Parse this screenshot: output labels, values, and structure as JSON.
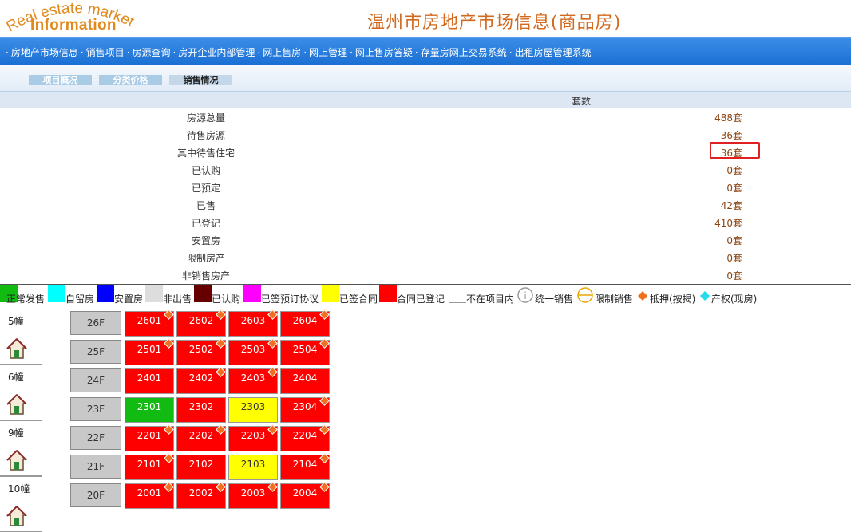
{
  "header": {
    "logo_arc_text": "Real estate market",
    "logo_info_text": "Information",
    "site_title": "温州市房地产市场信息(商品房)"
  },
  "nav": {
    "items": [
      "房地产市场信息",
      "销售项目",
      "房源查询",
      "房开企业内部管理",
      "网上售房",
      "网上管理",
      "网上售房答疑",
      "存量房网上交易系统",
      "出租房屋管理系统"
    ]
  },
  "subtabs": [
    "项目概况",
    "分类价格",
    "销售情况"
  ],
  "stats": {
    "column_header": "套数",
    "rows": [
      {
        "label": "房源总量",
        "value": "488套"
      },
      {
        "label": "待售房源",
        "value": "36套"
      },
      {
        "label": "其中待售住宅",
        "value": "36套"
      },
      {
        "label": "已认购",
        "value": "0套"
      },
      {
        "label": "已预定",
        "value": "0套"
      },
      {
        "label": "已售",
        "value": "42套"
      },
      {
        "label": "已登记",
        "value": "410套"
      },
      {
        "label": "安置房",
        "value": "0套"
      },
      {
        "label": "限制房产",
        "value": "0套"
      },
      {
        "label": "非销售房产",
        "value": "0套"
      }
    ]
  },
  "legend": [
    {
      "label": "正常发售",
      "color": "#11bb11"
    },
    {
      "label": "自留房",
      "color": "#00ffff"
    },
    {
      "label": "安置房",
      "color": "#0000ff"
    },
    {
      "label": "非出售",
      "color": "#dddddd"
    },
    {
      "label": "已认购",
      "color": "#660000"
    },
    {
      "label": "已签预订协议",
      "color": "#ff00ff"
    },
    {
      "label": "已签合同",
      "color": "#ffff00"
    },
    {
      "label": "合同已登记",
      "color": "#ff0000"
    },
    {
      "label": "不在项目内",
      "color": "#ffffff"
    },
    {
      "label": "统一销售",
      "icon": "info-circle-icon"
    },
    {
      "label": "限制销售",
      "icon": "restricted-circle-icon"
    },
    {
      "label": "抵押(按揭)",
      "icon": "orange-diamond-icon"
    },
    {
      "label": "产权(现房)",
      "icon": "cyan-diamond-icon"
    }
  ],
  "buildings": [
    "5幢",
    "6幢",
    "9幢",
    "10幢"
  ],
  "floors": [
    {
      "floor": "26F",
      "units": [
        {
          "no": "2601",
          "status": "red",
          "mortgage": true
        },
        {
          "no": "2602",
          "status": "red",
          "mortgage": true
        },
        {
          "no": "2603",
          "status": "red",
          "mortgage": true
        },
        {
          "no": "2604",
          "status": "red",
          "mortgage": true
        }
      ]
    },
    {
      "floor": "25F",
      "units": [
        {
          "no": "2501",
          "status": "red",
          "mortgage": true
        },
        {
          "no": "2502",
          "status": "red",
          "mortgage": true
        },
        {
          "no": "2503",
          "status": "red",
          "mortgage": true
        },
        {
          "no": "2504",
          "status": "red",
          "mortgage": true
        }
      ]
    },
    {
      "floor": "24F",
      "units": [
        {
          "no": "2401",
          "status": "red",
          "mortgage": false
        },
        {
          "no": "2402",
          "status": "red",
          "mortgage": true
        },
        {
          "no": "2403",
          "status": "red",
          "mortgage": true
        },
        {
          "no": "2404",
          "status": "red",
          "mortgage": false
        }
      ]
    },
    {
      "floor": "23F",
      "units": [
        {
          "no": "2301",
          "status": "green",
          "mortgage": false
        },
        {
          "no": "2302",
          "status": "red",
          "mortgage": false
        },
        {
          "no": "2303",
          "status": "yellow",
          "mortgage": false
        },
        {
          "no": "2304",
          "status": "red",
          "mortgage": true
        }
      ]
    },
    {
      "floor": "22F",
      "units": [
        {
          "no": "2201",
          "status": "red",
          "mortgage": true
        },
        {
          "no": "2202",
          "status": "red",
          "mortgage": true
        },
        {
          "no": "2203",
          "status": "red",
          "mortgage": true
        },
        {
          "no": "2204",
          "status": "red",
          "mortgage": true
        }
      ]
    },
    {
      "floor": "21F",
      "units": [
        {
          "no": "2101",
          "status": "red",
          "mortgage": true
        },
        {
          "no": "2102",
          "status": "red",
          "mortgage": false
        },
        {
          "no": "2103",
          "status": "yellow",
          "mortgage": false
        },
        {
          "no": "2104",
          "status": "red",
          "mortgage": true
        }
      ]
    },
    {
      "floor": "20F",
      "units": [
        {
          "no": "2001",
          "status": "red",
          "mortgage": true
        },
        {
          "no": "2002",
          "status": "red",
          "mortgage": true
        },
        {
          "no": "2003",
          "status": "red",
          "mortgage": true
        },
        {
          "no": "2004",
          "status": "red",
          "mortgage": true
        }
      ]
    }
  ]
}
